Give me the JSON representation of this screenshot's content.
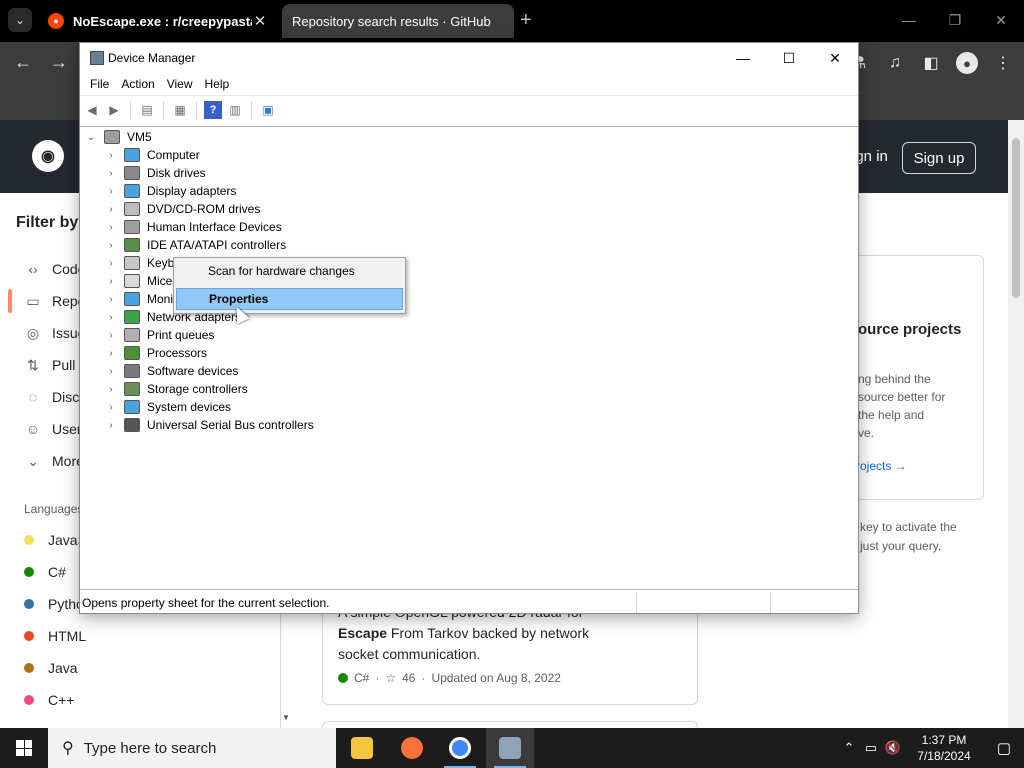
{
  "browser": {
    "tabs": [
      {
        "title": "NoEscape.exe : r/creepypasta",
        "active": false
      },
      {
        "title": "Repository search results · GitHub",
        "active": true
      }
    ],
    "new_tab": "+"
  },
  "github": {
    "signin": "Sign in",
    "signup": "Sign up",
    "filter_title": "Filter by",
    "filters": [
      {
        "label": "Code",
        "icon": "code-icon"
      },
      {
        "label": "Repositories",
        "icon": "repo-icon"
      },
      {
        "label": "Issues",
        "icon": "issue-icon"
      },
      {
        "label": "Pull requests",
        "icon": "pull-request-icon"
      },
      {
        "label": "Discussions",
        "icon": "discussion-icon"
      },
      {
        "label": "Users",
        "icon": "user-icon"
      },
      {
        "label": "More",
        "icon": "chevron-down-icon"
      }
    ],
    "languages_title": "Languages",
    "languages": [
      {
        "name": "JavaScript",
        "color": "#f1e05a"
      },
      {
        "name": "C#",
        "color": "#178600"
      },
      {
        "name": "Python",
        "color": "#3572A5"
      },
      {
        "name": "HTML",
        "color": "#e34c26"
      },
      {
        "name": "Java",
        "color": "#b07219"
      },
      {
        "name": "C++",
        "color": "#f34b7d"
      }
    ],
    "promo": {
      "title": "ource projects",
      "lines": [
        "ng behind the",
        "source better for",
        "the help and",
        "ve."
      ],
      "link": "rojects →"
    },
    "hint": [
      "key to activate the",
      "just your query."
    ],
    "repo": {
      "line1": "A simple OpenGL powered 2D radar for",
      "line2_bold": "Escape",
      "line2_rest": " From Tarkov backed by network",
      "line3": "socket communication.",
      "language": "C#",
      "language_color": "#178600",
      "stars": "46",
      "updated": "Updated on Aug 8, 2022"
    }
  },
  "device_manager": {
    "title": "Device Manager",
    "menu": [
      "File",
      "Action",
      "View",
      "Help"
    ],
    "root": "VM5",
    "items": [
      {
        "label": "Computer",
        "icon_color": "#4aa3df"
      },
      {
        "label": "Disk drives",
        "icon_color": "#8a8a8a"
      },
      {
        "label": "Display adapters",
        "icon_color": "#4aa3df"
      },
      {
        "label": "DVD/CD-ROM drives",
        "icon_color": "#bdbdbd"
      },
      {
        "label": "Human Interface Devices",
        "icon_color": "#9e9e9e"
      },
      {
        "label": "IDE ATA/ATAPI controllers",
        "icon_color": "#5a8f4a"
      },
      {
        "label": "Keyboards",
        "icon_color": "#c8c8c8"
      },
      {
        "label": "Mice and other pointing devices",
        "icon_color": "#d9d9d9"
      },
      {
        "label": "Monitors",
        "icon_color": "#4aa3df"
      },
      {
        "label": "Network adapters",
        "icon_color": "#3fa34d"
      },
      {
        "label": "Print queues",
        "icon_color": "#b0b0b0"
      },
      {
        "label": "Processors",
        "icon_color": "#4f8f3a"
      },
      {
        "label": "Software devices",
        "icon_color": "#7a7a7a"
      },
      {
        "label": "Storage controllers",
        "icon_color": "#6a8f5a"
      },
      {
        "label": "System devices",
        "icon_color": "#4aa3df"
      },
      {
        "label": "Universal Serial Bus controllers",
        "icon_color": "#555555"
      }
    ],
    "context_menu": {
      "scan": "Scan for hardware changes",
      "properties": "Properties"
    },
    "status": "Opens property sheet for the current selection."
  },
  "taskbar": {
    "search_placeholder": "Type here to search",
    "time": "1:37 PM",
    "date": "7/18/2024"
  }
}
